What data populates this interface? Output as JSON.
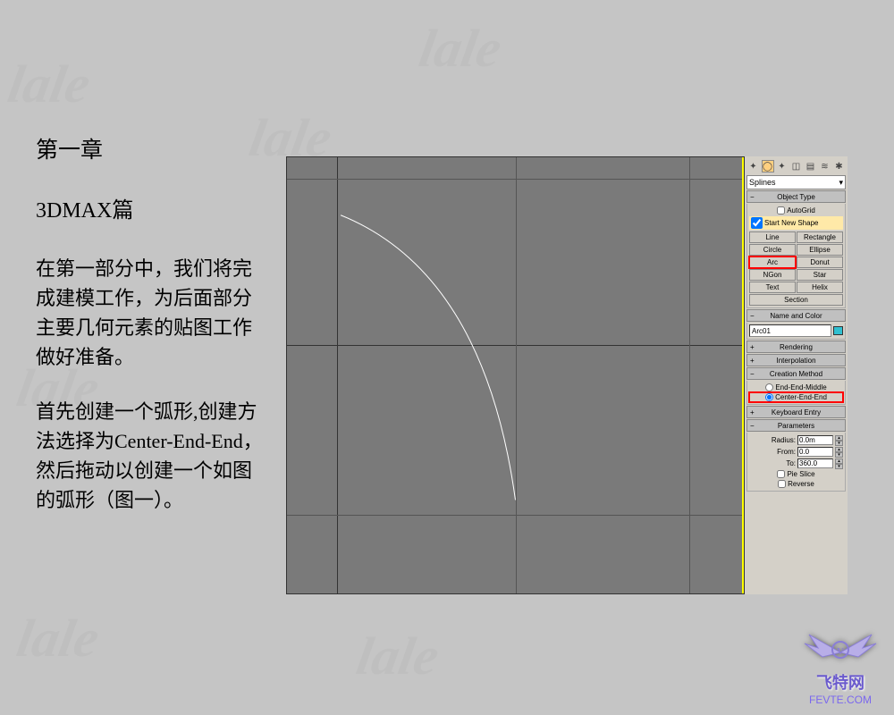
{
  "text": {
    "chapter": "第一章",
    "section": "3DMAX篇",
    "para1": "在第一部分中，我们将完成建模工作，为后面部分主要几何元素的贴图工作做好准备。",
    "para2": "首先创建一个弧形,创建方法选择为Center-End-End，然后拖动以创建一个如图的弧形（图一）。"
  },
  "panel": {
    "dropdown": "Splines",
    "rollouts": {
      "objectType": "Object Type",
      "nameColor": "Name and Color",
      "rendering": "Rendering",
      "interpolation": "Interpolation",
      "creationMethod": "Creation Method",
      "keyboardEntry": "Keyboard Entry",
      "parameters": "Parameters"
    },
    "autogrid": "AutoGrid",
    "startNewShape": "Start New Shape",
    "shapes": {
      "line": "Line",
      "rectangle": "Rectangle",
      "circle": "Circle",
      "ellipse": "Ellipse",
      "arc": "Arc",
      "donut": "Donut",
      "ngon": "NGon",
      "star": "Star",
      "text": "Text",
      "helix": "Helix",
      "section": "Section"
    },
    "objectName": "Arc01",
    "creation": {
      "endEndMiddle": "End-End-Middle",
      "centerEndEnd": "Center-End-End"
    },
    "params": {
      "radiusLabel": "Radius:",
      "radiusValue": "0.0m",
      "fromLabel": "From:",
      "fromValue": "0.0",
      "toLabel": "To:",
      "toValue": "360.0",
      "pieSlice": "Pie Slice",
      "reverse": "Reverse"
    }
  },
  "logo": {
    "name": "飞特网",
    "url": "FEVTE.COM"
  },
  "watermark": "lale"
}
